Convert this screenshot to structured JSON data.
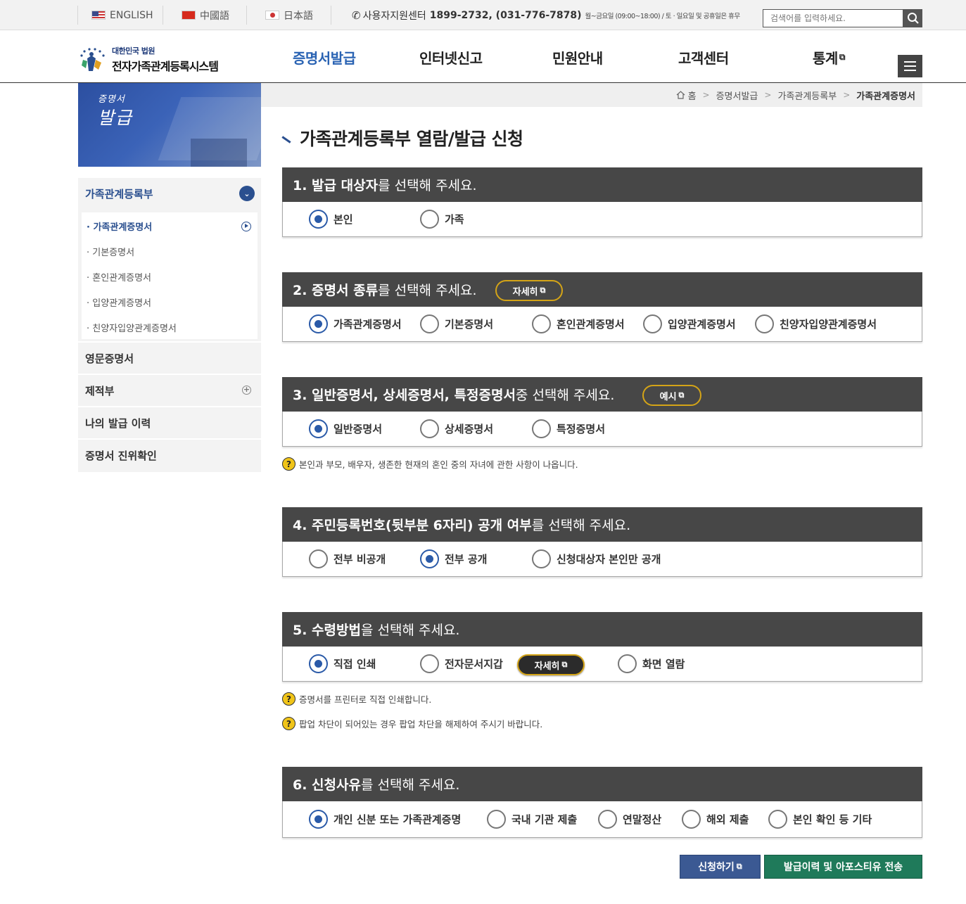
{
  "topbar": {
    "langs": [
      "ENGLISH",
      "中國語",
      "日本語"
    ],
    "support_label": "사용자지원센터",
    "support_numbers": "1899-2732, (031-776-7878)",
    "support_hours": "월~금요일 (09:00~18:00) / 토 · 일요일 및 공휴일은 휴무",
    "search_placeholder": "검색어를 입력하세요."
  },
  "logo": {
    "small": "대한민국 법원",
    "big": "전자가족관계등록시스템"
  },
  "gnb": [
    "증명서발급",
    "인터넷신고",
    "민원안내",
    "고객센터",
    "통계"
  ],
  "banner": {
    "line1": "증명서",
    "line2": "발급"
  },
  "sidebar": {
    "head": "가족관계등록부",
    "sub_items": [
      "가족관계증명서",
      "기본증명서",
      "혼인관계증명서",
      "입양관계증명서",
      "친양자입양관계증명서"
    ],
    "items": [
      "영문증명서",
      "제적부",
      "나의 발급 이력",
      "증명서 진위확인"
    ]
  },
  "breadcrumb": [
    "홈",
    "증명서발급",
    "가족관계등록부",
    "가족관계증명서"
  ],
  "page_title": "가족관계등록부 열람/발급 신청",
  "sections": [
    {
      "bold": "1. 발급 대상자",
      "rest": "를 선택해 주세요.",
      "options": [
        "본인",
        "가족"
      ],
      "selected": "본인"
    },
    {
      "bold": "2. 증명서 종류",
      "rest": "를 선택해 주세요.",
      "pill": "자세히",
      "options": [
        "가족관계증명서",
        "기본증명서",
        "혼인관계증명서",
        "입양관계증명서",
        "친양자입양관계증명서"
      ],
      "selected": "가족관계증명서"
    },
    {
      "bold": "3. 일반증명서, 상세증명서, 특정증명서",
      "rest": " 중 선택해 주세요.",
      "pill": "예시",
      "options": [
        "일반증명서",
        "상세증명서",
        "특정증명서"
      ],
      "selected": "일반증명서",
      "note": "본인과 부모, 배우자, 생존한 현재의 혼인 중의 자녀에 관한 사항이 나옵니다."
    },
    {
      "bold": "4. 주민등록번호(뒷부분 6자리) 공개 여부",
      "rest": "를 선택해 주세요.",
      "options": [
        "전부 비공개",
        "전부 공개",
        "신청대상자 본인만 공개"
      ],
      "selected": "전부 공개"
    },
    {
      "bold": "5. 수령방법",
      "rest": "을 선택해 주세요.",
      "options": [
        "직접 인쇄",
        "전자문서지갑",
        "화면 열람"
      ],
      "inline_pill": "자세히",
      "selected": "직접 인쇄",
      "notes": [
        "증명서를 프린터로 직접 인쇄합니다.",
        "팝업 차단이 되어있는 경우 팝업 차단을 해제하여 주시기 바랍니다."
      ]
    },
    {
      "bold": "6. 신청사유",
      "rest": "를 선택해 주세요.",
      "options": [
        "개인 신분 또는 가족관계증명",
        "국내 기관 제출",
        "연말정산",
        "해외 제출",
        "본인 확인 등 기타"
      ],
      "selected": "개인 신분 또는 가족관계증명"
    }
  ],
  "buttons": {
    "apply": "신청하기",
    "history": "발급이력 및 아포스티유 전송"
  },
  "colors": {
    "accent_blue": "#2a5aa8",
    "section_header": "#474747",
    "pill_border": "#d4a417",
    "apply_button": "#3b5993",
    "history_button": "#1f7a5a"
  },
  "icons": [
    "phone-icon",
    "search-icon",
    "menu-icon",
    "home-icon",
    "external-link-icon",
    "question-icon",
    "chevron-down-icon",
    "play-circle-icon",
    "plus-circle-icon"
  ]
}
